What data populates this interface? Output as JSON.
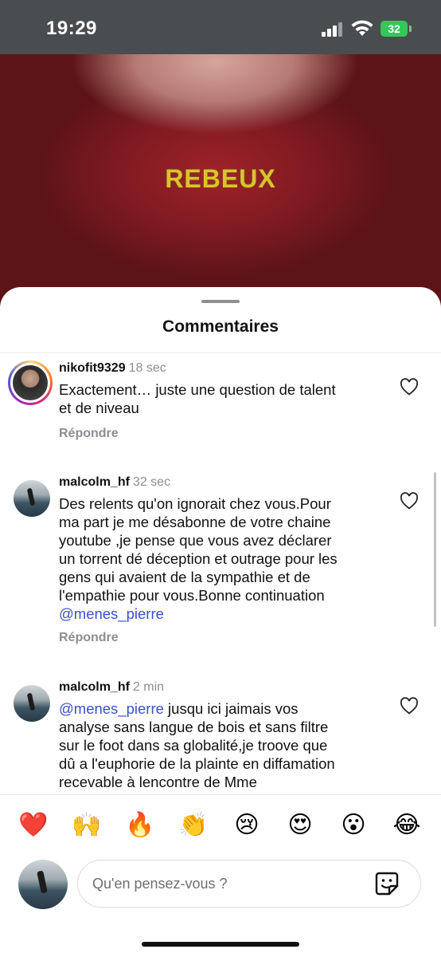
{
  "status_bar": {
    "time": "19:29",
    "battery": "32"
  },
  "video": {
    "caption": "REBEUX"
  },
  "sheet": {
    "title": "Commentaires",
    "comments": [
      {
        "username": "nikofit9329",
        "time": "18 sec",
        "text_lines": [
          "Exactement… juste une question de talent",
          "et de niveau"
        ],
        "reply_label": "Répondre"
      },
      {
        "username": "malcolm_hf",
        "time": "32 sec",
        "text_lines": [
          "Des relents qu'on ignorait chez vous.Pour",
          "ma part je me désabonne de votre chaine",
          "youtube ,je pense que vous avez déclarer",
          "un torrent dé déception et outrage pour les",
          "gens qui avaient de la sympathie et de",
          "l'empathie pour vous.Bonne continuation"
        ],
        "mention": "@menes_pierre",
        "reply_label": "Répondre"
      },
      {
        "username": "malcolm_hf",
        "time": "2 min",
        "mention": "@menes_pierre",
        "first_line_rest": " jusqu ici jaimais vos",
        "text_lines": [
          "analyse sans langue de bois et sans filtre",
          "sur le foot dans sa globalité,je troove que",
          "dû a l'euphorie de la plainte en diffamation",
          "recevable à lencontre de Mme"
        ]
      }
    ]
  },
  "reactions": [
    {
      "emoji": "❤️",
      "name": "red-heart"
    },
    {
      "emoji": "🙌",
      "name": "raising-hands"
    },
    {
      "emoji": "🔥",
      "name": "fire"
    },
    {
      "emoji": "👏",
      "name": "clapping-hands"
    },
    {
      "emoji": "😢",
      "name": "crying-face"
    },
    {
      "emoji": "😍",
      "name": "heart-eyes"
    },
    {
      "emoji": "😮",
      "name": "open-mouth"
    },
    {
      "emoji": "😂",
      "name": "tears-of-joy"
    }
  ],
  "composer": {
    "placeholder": "Qu'en pensez-vous ?"
  }
}
